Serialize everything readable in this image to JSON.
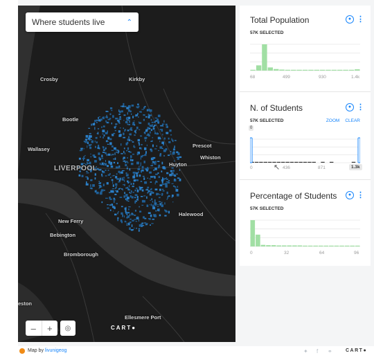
{
  "map": {
    "layer_selector": "Where students live",
    "zoom_out": "–",
    "zoom_in": "+",
    "locate_symbol": "◎",
    "carto_logo": "CART●",
    "places": [
      {
        "id": "crosby",
        "label": "Crosby",
        "big": false
      },
      {
        "id": "kirkby",
        "label": "Kirkby",
        "big": false
      },
      {
        "id": "bootle",
        "label": "Bootle",
        "big": false
      },
      {
        "id": "wallasey",
        "label": "Wallasey",
        "big": false
      },
      {
        "id": "liverpool",
        "label": "LIVERPOOL",
        "big": true
      },
      {
        "id": "prescot",
        "label": "Prescot",
        "big": false
      },
      {
        "id": "huyton",
        "label": "Huyton",
        "big": false
      },
      {
        "id": "whiston",
        "label": "Whiston",
        "big": false
      },
      {
        "id": "halewood",
        "label": "Halewood",
        "big": false
      },
      {
        "id": "newferry",
        "label": "New Ferry",
        "big": false
      },
      {
        "id": "bebington",
        "label": "Bebington",
        "big": false
      },
      {
        "id": "bromborough",
        "label": "Bromborough",
        "big": false
      },
      {
        "id": "neston",
        "label": "eston",
        "big": false
      },
      {
        "id": "ellesmere",
        "label": "Ellesmere Port",
        "big": false
      }
    ]
  },
  "widgets": {
    "population": {
      "title": "Total Population",
      "selected": "57K SELECTED",
      "ticks": [
        "68",
        "499",
        "930",
        "1.4k"
      ],
      "bins": [
        0.02,
        0.2,
        1.0,
        0.12,
        0.06,
        0.04,
        0.03,
        0.03,
        0.02,
        0.02,
        0.02,
        0.02,
        0.02,
        0.01,
        0.01,
        0.01,
        0.01,
        0.01,
        0.05
      ]
    },
    "students": {
      "title": "N. of Students",
      "selected": "57K SELECTED",
      "zoom": "ZOOM",
      "clear": "CLEAR",
      "range_min": "0",
      "range_max": "1.3k",
      "ticks": [
        "0",
        "436",
        "871"
      ],
      "bins": [
        0.02,
        0.02,
        0.03,
        0.02,
        0.02,
        0.02,
        0.02,
        0.01,
        0.02,
        0.01,
        0.02,
        0.01,
        0.02,
        0.01,
        0.01,
        0.0,
        0.01,
        0.0,
        0.01,
        0.0,
        0.0,
        0.0,
        0.0,
        0.02,
        0.0
      ]
    },
    "percentage": {
      "title": "Percentage of Students",
      "selected": "57K SELECTED",
      "ticks": [
        "0",
        "32",
        "64",
        "96"
      ],
      "bins": [
        1.0,
        0.45,
        0.06,
        0.05,
        0.05,
        0.04,
        0.04,
        0.04,
        0.04,
        0.04,
        0.03,
        0.03,
        0.03,
        0.03,
        0.03,
        0.03,
        0.03,
        0.03,
        0.03,
        0.03,
        0.03
      ]
    }
  },
  "footer": {
    "map_by": "Map by",
    "user": "livunigeog",
    "carto": "CART●"
  },
  "colors": {
    "accent": "#1785fb",
    "bar": "#a1dfa4",
    "map_bg": "#1c1c1c",
    "water": "#333333",
    "points": "#2b7fc7"
  }
}
